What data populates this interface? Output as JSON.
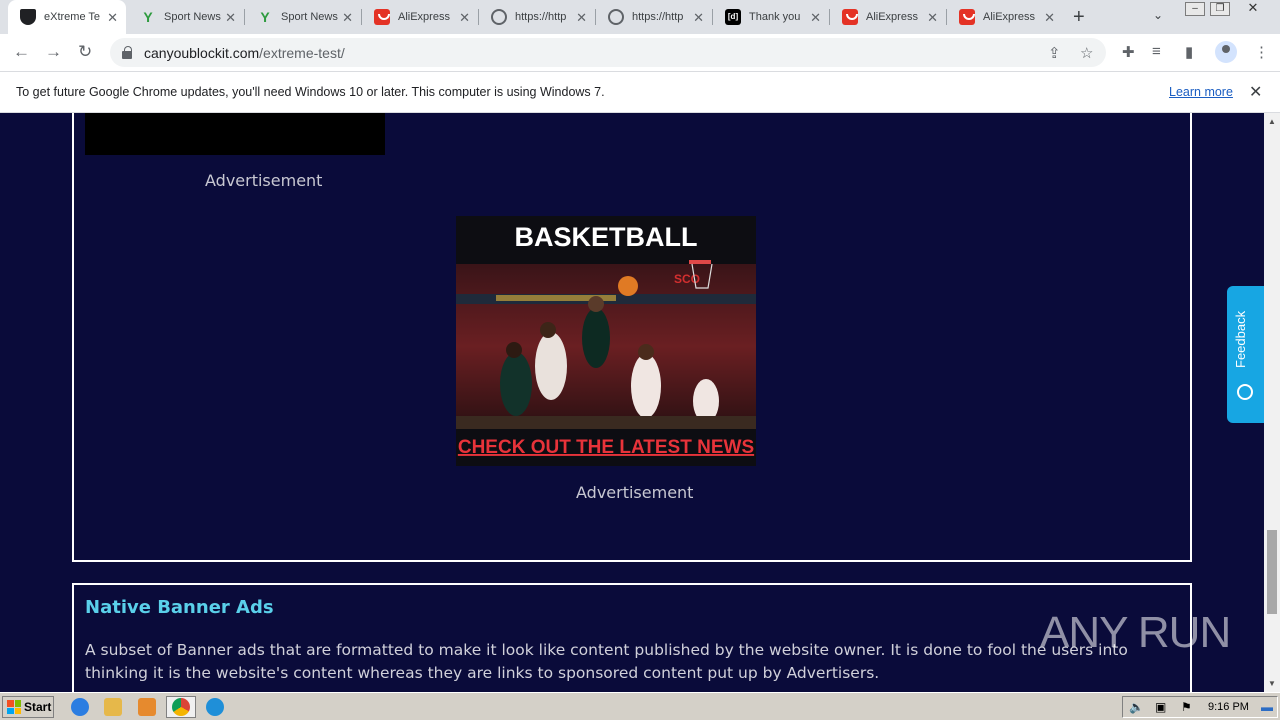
{
  "browser": {
    "tabs": [
      {
        "title": "eXtreme Te",
        "icon": "shield-icon",
        "active": true
      },
      {
        "title": "Sport News",
        "icon": "y-icon"
      },
      {
        "title": "Sport News",
        "icon": "y-icon"
      },
      {
        "title": "AliExpress",
        "icon": "aliexpress-icon"
      },
      {
        "title": "https://http",
        "icon": "globe-icon"
      },
      {
        "title": "https://http",
        "icon": "globe-icon"
      },
      {
        "title": "Thank you",
        "icon": "dl-icon"
      },
      {
        "title": "AliExpress",
        "icon": "aliexpress-icon"
      },
      {
        "title": "AliExpress",
        "icon": "aliexpress-icon"
      }
    ],
    "url_host": "canyoublockit.com",
    "url_path": "/extreme-test/"
  },
  "infobar": {
    "message": "To get future Google Chrome updates, you'll need Windows 10 or later. This computer is using Windows 7.",
    "link": "Learn more"
  },
  "page": {
    "ad_label_top": "Advertisement",
    "ad_label_bottom": "Advertisement",
    "ad_banner": {
      "headline": "BASKETBALL",
      "cta": "CHECK OUT THE LATEST NEWS",
      "scoreboard": "SCO",
      "bg_color": "#0d0d12",
      "cta_color": "#e8333a"
    },
    "native_section": {
      "heading": "Native Banner Ads",
      "body": "A subset of Banner ads that are formatted to make it look like content published by the website owner. It is done to fool the users into thinking it is the website's content whereas they are links to sponsored content put up by Advertisers."
    },
    "feedback_label": "Feedback",
    "watermark": "ANY RUN"
  },
  "taskbar": {
    "start": "Start",
    "time": "9:16 PM"
  },
  "colors": {
    "page_bg": "#0a0b3a",
    "heading": "#5ad0ea",
    "feedback": "#17a6e3"
  }
}
